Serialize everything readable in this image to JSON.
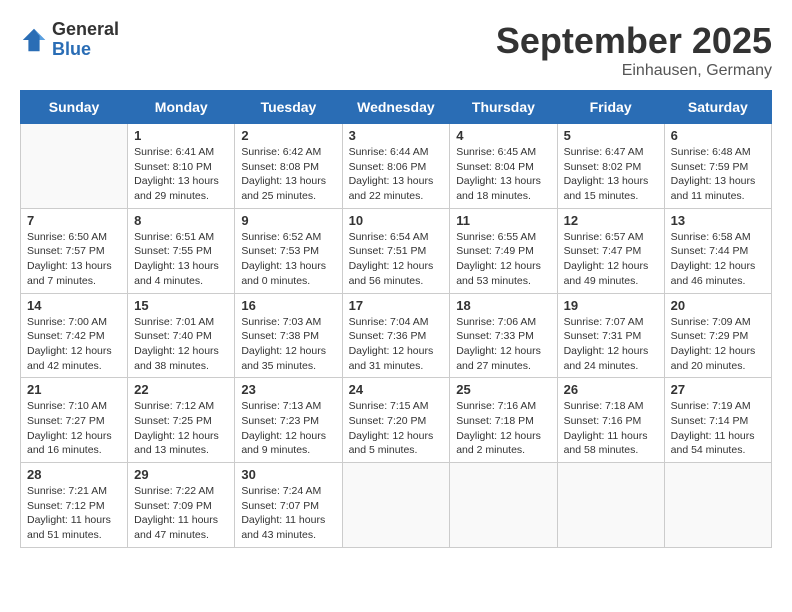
{
  "header": {
    "logo_general": "General",
    "logo_blue": "Blue",
    "month_title": "September 2025",
    "location": "Einhausen, Germany"
  },
  "days_of_week": [
    "Sunday",
    "Monday",
    "Tuesday",
    "Wednesday",
    "Thursday",
    "Friday",
    "Saturday"
  ],
  "weeks": [
    [
      {
        "day": "",
        "info": ""
      },
      {
        "day": "1",
        "info": "Sunrise: 6:41 AM\nSunset: 8:10 PM\nDaylight: 13 hours\nand 29 minutes."
      },
      {
        "day": "2",
        "info": "Sunrise: 6:42 AM\nSunset: 8:08 PM\nDaylight: 13 hours\nand 25 minutes."
      },
      {
        "day": "3",
        "info": "Sunrise: 6:44 AM\nSunset: 8:06 PM\nDaylight: 13 hours\nand 22 minutes."
      },
      {
        "day": "4",
        "info": "Sunrise: 6:45 AM\nSunset: 8:04 PM\nDaylight: 13 hours\nand 18 minutes."
      },
      {
        "day": "5",
        "info": "Sunrise: 6:47 AM\nSunset: 8:02 PM\nDaylight: 13 hours\nand 15 minutes."
      },
      {
        "day": "6",
        "info": "Sunrise: 6:48 AM\nSunset: 7:59 PM\nDaylight: 13 hours\nand 11 minutes."
      }
    ],
    [
      {
        "day": "7",
        "info": "Sunrise: 6:50 AM\nSunset: 7:57 PM\nDaylight: 13 hours\nand 7 minutes."
      },
      {
        "day": "8",
        "info": "Sunrise: 6:51 AM\nSunset: 7:55 PM\nDaylight: 13 hours\nand 4 minutes."
      },
      {
        "day": "9",
        "info": "Sunrise: 6:52 AM\nSunset: 7:53 PM\nDaylight: 13 hours\nand 0 minutes."
      },
      {
        "day": "10",
        "info": "Sunrise: 6:54 AM\nSunset: 7:51 PM\nDaylight: 12 hours\nand 56 minutes."
      },
      {
        "day": "11",
        "info": "Sunrise: 6:55 AM\nSunset: 7:49 PM\nDaylight: 12 hours\nand 53 minutes."
      },
      {
        "day": "12",
        "info": "Sunrise: 6:57 AM\nSunset: 7:47 PM\nDaylight: 12 hours\nand 49 minutes."
      },
      {
        "day": "13",
        "info": "Sunrise: 6:58 AM\nSunset: 7:44 PM\nDaylight: 12 hours\nand 46 minutes."
      }
    ],
    [
      {
        "day": "14",
        "info": "Sunrise: 7:00 AM\nSunset: 7:42 PM\nDaylight: 12 hours\nand 42 minutes."
      },
      {
        "day": "15",
        "info": "Sunrise: 7:01 AM\nSunset: 7:40 PM\nDaylight: 12 hours\nand 38 minutes."
      },
      {
        "day": "16",
        "info": "Sunrise: 7:03 AM\nSunset: 7:38 PM\nDaylight: 12 hours\nand 35 minutes."
      },
      {
        "day": "17",
        "info": "Sunrise: 7:04 AM\nSunset: 7:36 PM\nDaylight: 12 hours\nand 31 minutes."
      },
      {
        "day": "18",
        "info": "Sunrise: 7:06 AM\nSunset: 7:33 PM\nDaylight: 12 hours\nand 27 minutes."
      },
      {
        "day": "19",
        "info": "Sunrise: 7:07 AM\nSunset: 7:31 PM\nDaylight: 12 hours\nand 24 minutes."
      },
      {
        "day": "20",
        "info": "Sunrise: 7:09 AM\nSunset: 7:29 PM\nDaylight: 12 hours\nand 20 minutes."
      }
    ],
    [
      {
        "day": "21",
        "info": "Sunrise: 7:10 AM\nSunset: 7:27 PM\nDaylight: 12 hours\nand 16 minutes."
      },
      {
        "day": "22",
        "info": "Sunrise: 7:12 AM\nSunset: 7:25 PM\nDaylight: 12 hours\nand 13 minutes."
      },
      {
        "day": "23",
        "info": "Sunrise: 7:13 AM\nSunset: 7:23 PM\nDaylight: 12 hours\nand 9 minutes."
      },
      {
        "day": "24",
        "info": "Sunrise: 7:15 AM\nSunset: 7:20 PM\nDaylight: 12 hours\nand 5 minutes."
      },
      {
        "day": "25",
        "info": "Sunrise: 7:16 AM\nSunset: 7:18 PM\nDaylight: 12 hours\nand 2 minutes."
      },
      {
        "day": "26",
        "info": "Sunrise: 7:18 AM\nSunset: 7:16 PM\nDaylight: 11 hours\nand 58 minutes."
      },
      {
        "day": "27",
        "info": "Sunrise: 7:19 AM\nSunset: 7:14 PM\nDaylight: 11 hours\nand 54 minutes."
      }
    ],
    [
      {
        "day": "28",
        "info": "Sunrise: 7:21 AM\nSunset: 7:12 PM\nDaylight: 11 hours\nand 51 minutes."
      },
      {
        "day": "29",
        "info": "Sunrise: 7:22 AM\nSunset: 7:09 PM\nDaylight: 11 hours\nand 47 minutes."
      },
      {
        "day": "30",
        "info": "Sunrise: 7:24 AM\nSunset: 7:07 PM\nDaylight: 11 hours\nand 43 minutes."
      },
      {
        "day": "",
        "info": ""
      },
      {
        "day": "",
        "info": ""
      },
      {
        "day": "",
        "info": ""
      },
      {
        "day": "",
        "info": ""
      }
    ]
  ]
}
